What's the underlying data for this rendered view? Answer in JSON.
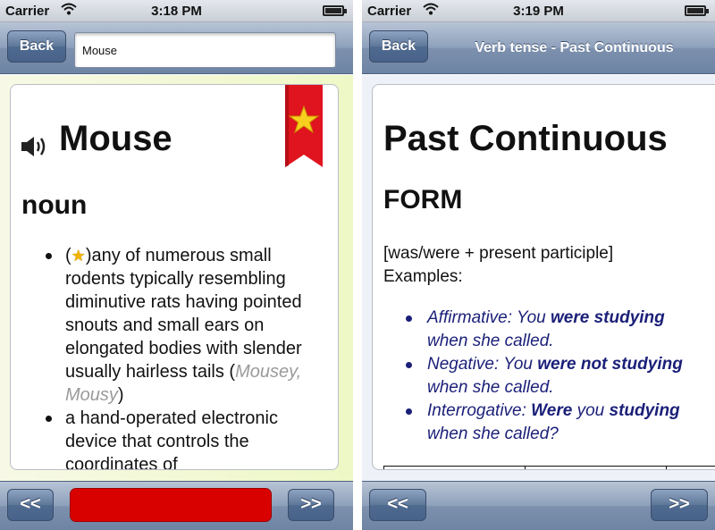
{
  "left_screen": {
    "status": {
      "carrier": "Carrier",
      "time": "3:18 PM",
      "wifi_icon": "wifi-icon",
      "battery_icon": "battery-icon"
    },
    "nav": {
      "back_label": "Back",
      "search_value": "Mouse"
    },
    "entry": {
      "word": "Mouse",
      "part_of_speech": "noun",
      "speaker_icon": "speaker-icon",
      "bookmark_icon": "bookmark-star-icon",
      "definitions": [
        {
          "open_paren": "(",
          "star_icon": "star-icon",
          "text": ")any of numerous small rodents typically resembling diminutive rats having pointed snouts and small ears on elongated bodies with slender usually hairless tails (",
          "synonyms": "Mousey, Mousy",
          "close": ")"
        },
        {
          "text": "a hand-operated electronic device that controls the coordinates of"
        }
      ]
    },
    "toolbar": {
      "prev_label": "<<",
      "next_label": ">>",
      "bar_color": "#d90000"
    }
  },
  "right_screen": {
    "status": {
      "carrier": "Carrier",
      "time": "3:19 PM",
      "wifi_icon": "wifi-icon",
      "battery_icon": "battery-icon"
    },
    "nav": {
      "back_label": "Back",
      "title": "Verb tense - Past Continuous"
    },
    "lesson": {
      "title": "Past Continuous",
      "heading": "FORM",
      "formula": "[was/were + present participle]",
      "examples_label": "Examples:",
      "examples": [
        {
          "pre": "Affirmative: You ",
          "bold": "were studying",
          "post": " when she called."
        },
        {
          "pre": "Negative: You ",
          "bold": "were not studying",
          "post": " when she called."
        },
        {
          "pre": "Interrogative: ",
          "bold": "Were",
          "mid": " you ",
          "bold2": "studying",
          "post": " when she called?"
        }
      ]
    },
    "toolbar": {
      "prev_label": "<<",
      "next_label": ">>"
    }
  },
  "colors": {
    "text_accent": "#1a1f78",
    "synonym_gray": "#9a9a9a",
    "bookmark_red": "#e0141e"
  }
}
